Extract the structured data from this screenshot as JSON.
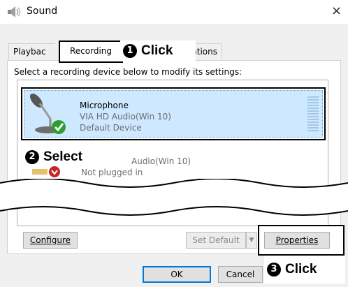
{
  "window": {
    "title": "Sound",
    "close_glyph": "×",
    "icon": "speaker-icon"
  },
  "tabs": {
    "playback": "Playbac",
    "recording": "Recording",
    "communications": "ations"
  },
  "callouts": {
    "step1_num": "1",
    "step1_text": "Click",
    "step2_num": "2",
    "step2_text": "Select",
    "step3_num": "3",
    "step3_text": "Click"
  },
  "instruction": "Select a recording device below to modify its settings:",
  "devices": [
    {
      "name": "Microphone",
      "driver": "VIA HD Audio(Win 10)",
      "status": "Default Device",
      "icon": "microphone-icon",
      "badge": "check-icon"
    },
    {
      "driver": "Audio(Win 10)",
      "status": "Not plugged in",
      "icon": "line-in-icon",
      "badge": "down-arrow-icon"
    }
  ],
  "buttons": {
    "configure": "Configure",
    "set_default": "Set Default",
    "properties": "Properties",
    "ok": "OK",
    "cancel": "Cancel"
  },
  "colors": {
    "selection": "#cde8ff",
    "accent": "#0078d7",
    "check": "#2e9d2e"
  }
}
